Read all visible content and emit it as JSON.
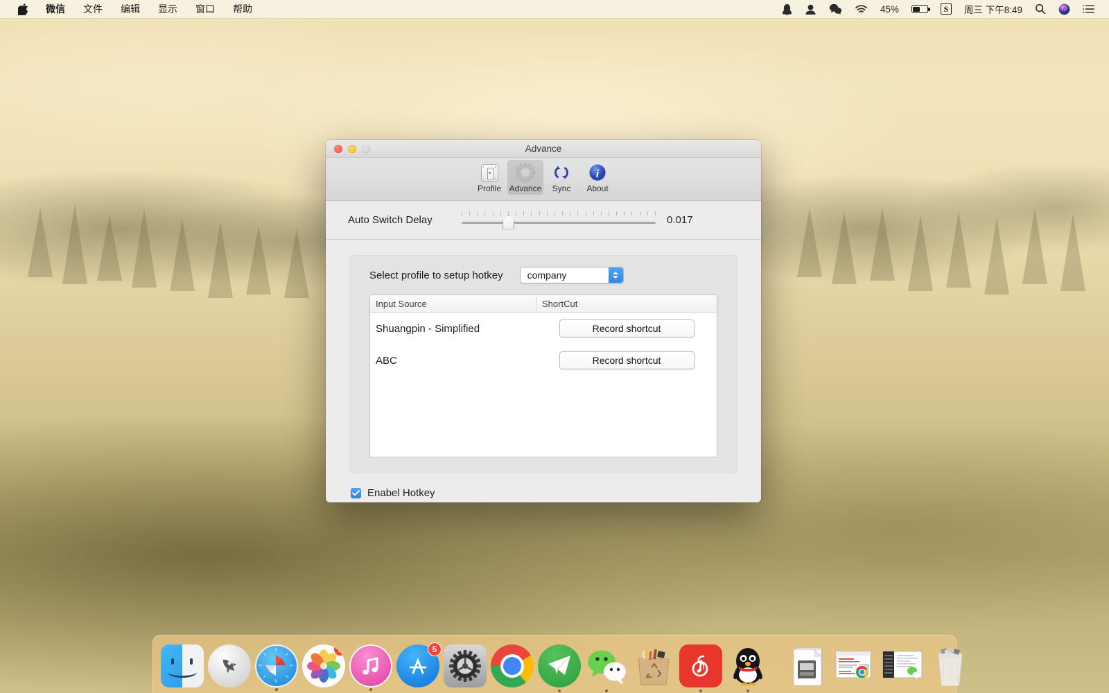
{
  "menubar": {
    "apple_icon": "apple-logo-icon",
    "left_items": [
      {
        "label": "微信",
        "bold": true
      },
      {
        "label": "文件",
        "bold": false
      },
      {
        "label": "编辑",
        "bold": false
      },
      {
        "label": "显示",
        "bold": false
      },
      {
        "label": "窗口",
        "bold": false
      },
      {
        "label": "帮助",
        "bold": false
      }
    ],
    "right": {
      "qq_icon": "qq-penguin-icon",
      "user_icon": "user-silhouette-icon",
      "wechat_icon": "wechat-icon",
      "wifi_icon": "wifi-icon",
      "battery_percent": "45%",
      "battery_icon": "battery-icon",
      "input_method": "S",
      "input_method_icon": "sogou-input-icon",
      "datetime": "周三 下午8:49",
      "search_icon": "spotlight-search-icon",
      "siri_icon": "siri-icon",
      "notification_icon": "notification-center-icon"
    }
  },
  "window": {
    "title": "Advance",
    "traffic": {
      "close": "close-button",
      "minimize": "minimize-button",
      "zoom": "zoom-button"
    },
    "toolbar": {
      "items": [
        {
          "label": "Profile",
          "icon": "profile-card-icon",
          "selected": false
        },
        {
          "label": "Advance",
          "icon": "gear-icon",
          "selected": true
        },
        {
          "label": "Sync",
          "icon": "sync-arrows-icon",
          "selected": false
        },
        {
          "label": "About",
          "icon": "info-circle-icon",
          "selected": false
        }
      ]
    },
    "slider_row": {
      "label": "Auto Switch Delay",
      "value": "0.017",
      "tick_count": 26,
      "thumb_position_percent": 24
    },
    "panel": {
      "profile_label": "Select profile to setup hotkey",
      "profile_value": "company",
      "profile_options": [
        "company"
      ],
      "table": {
        "columns": [
          "Input Source",
          "ShortCut"
        ],
        "rows": [
          {
            "input_source": "Shuangpin - Simplified",
            "button": "Record shortcut"
          },
          {
            "input_source": "ABC",
            "button": "Record shortcut"
          }
        ]
      }
    },
    "checkbox": {
      "label": "Enabel Hotkey",
      "checked": true
    }
  },
  "dock": {
    "items": [
      {
        "name": "finder",
        "label": "Finder",
        "running": true,
        "badge": null
      },
      {
        "name": "launchpad",
        "label": "Launchpad",
        "running": false,
        "badge": null
      },
      {
        "name": "safari",
        "label": "Safari",
        "running": true,
        "badge": null
      },
      {
        "name": "photos",
        "label": "Photos",
        "running": false,
        "badge": "1"
      },
      {
        "name": "itunes",
        "label": "iTunes",
        "running": true,
        "badge": null
      },
      {
        "name": "app-store",
        "label": "App Store",
        "running": false,
        "badge": "5"
      },
      {
        "name": "system-preferences",
        "label": "System Preferences",
        "running": true,
        "badge": null
      },
      {
        "name": "google-chrome",
        "label": "Google Chrome",
        "running": true,
        "badge": null
      },
      {
        "name": "telegram",
        "label": "Telegram",
        "running": true,
        "badge": null
      },
      {
        "name": "wechat",
        "label": "WeChat",
        "running": true,
        "badge": null
      },
      {
        "name": "recycle-bag",
        "label": "Recycle",
        "running": false,
        "badge": null
      },
      {
        "name": "netease-music",
        "label": "NetEase Music",
        "running": true,
        "badge": null
      },
      {
        "name": "qq",
        "label": "QQ",
        "running": true,
        "badge": null
      }
    ],
    "minimized": [
      {
        "name": "document-stack",
        "label": "Document"
      },
      {
        "name": "chrome-window",
        "label": "Chrome Window"
      },
      {
        "name": "wechat-window",
        "label": "WeChat Window"
      }
    ],
    "trash": {
      "name": "trash",
      "label": "Trash"
    }
  },
  "colors": {
    "accent_blue": "#2f86e8",
    "badge_red": "#f6443a",
    "window_bg": "#ececec",
    "panel_bg": "#e3e3e3"
  }
}
